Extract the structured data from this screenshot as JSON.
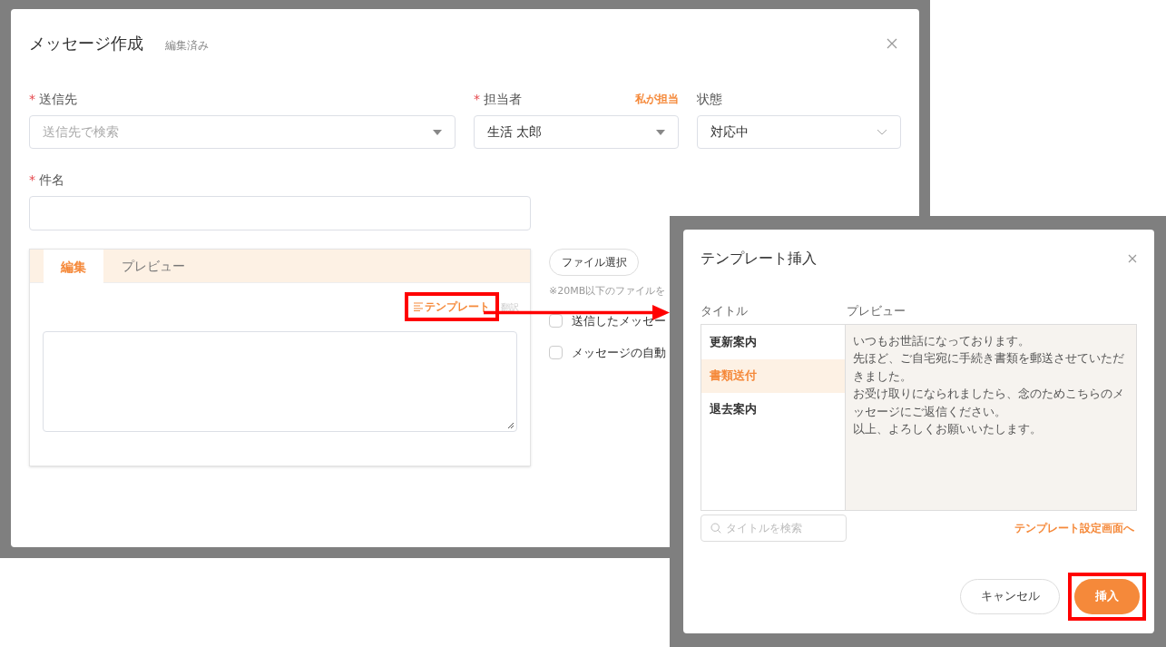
{
  "compose_dialog": {
    "title": "メッセージ作成",
    "status_badge": "編集済み",
    "recipient": {
      "label": "送信先",
      "required_mark": "*",
      "placeholder": "送信先で検索"
    },
    "assignee": {
      "label": "担当者",
      "required_mark": "*",
      "value": "生活 太郎",
      "assign_me": "私が担当"
    },
    "status": {
      "label": "状態",
      "value": "対応中"
    },
    "subject": {
      "label": "件名",
      "required_mark": "*"
    },
    "editor": {
      "tabs": [
        {
          "label": "編集",
          "selected": true
        },
        {
          "label": "プレビュー",
          "selected": false
        }
      ],
      "template_button": {
        "label": "テンプレート",
        "highlighted": true
      },
      "translate_link": {
        "label": "翻訳",
        "disabled": true
      }
    },
    "attachment": {
      "button": "ファイル選択",
      "note": "※20MB以下のファイルを"
    },
    "options": [
      {
        "label": "送信したメッセー",
        "checked": false
      },
      {
        "label": "メッセージの自動",
        "checked": false
      }
    ]
  },
  "template_dialog": {
    "title": "テンプレート挿入",
    "title_column": "タイトル",
    "preview_column": "プレビュー",
    "templates": [
      {
        "title": "更新案内",
        "selected": false
      },
      {
        "title": "書類送付",
        "selected": true
      },
      {
        "title": "退去案内",
        "selected": false
      }
    ],
    "preview_lines": [
      "いつもお世話になっております。",
      "先ほど、ご自宅宛に手続き書類を郵送させていただきました。",
      "お受け取りになられましたら、念のためこちらのメッセージにご返信ください。",
      "以上、よろしくお願いいたします。"
    ],
    "search": {
      "placeholder": "タイトルを検索"
    },
    "settings_link": "テンプレート設定画面へ",
    "cancel_button": {
      "label": "キャンセル",
      "highlighted": false
    },
    "insert_button": {
      "label": "挿入",
      "highlighted": true
    }
  }
}
